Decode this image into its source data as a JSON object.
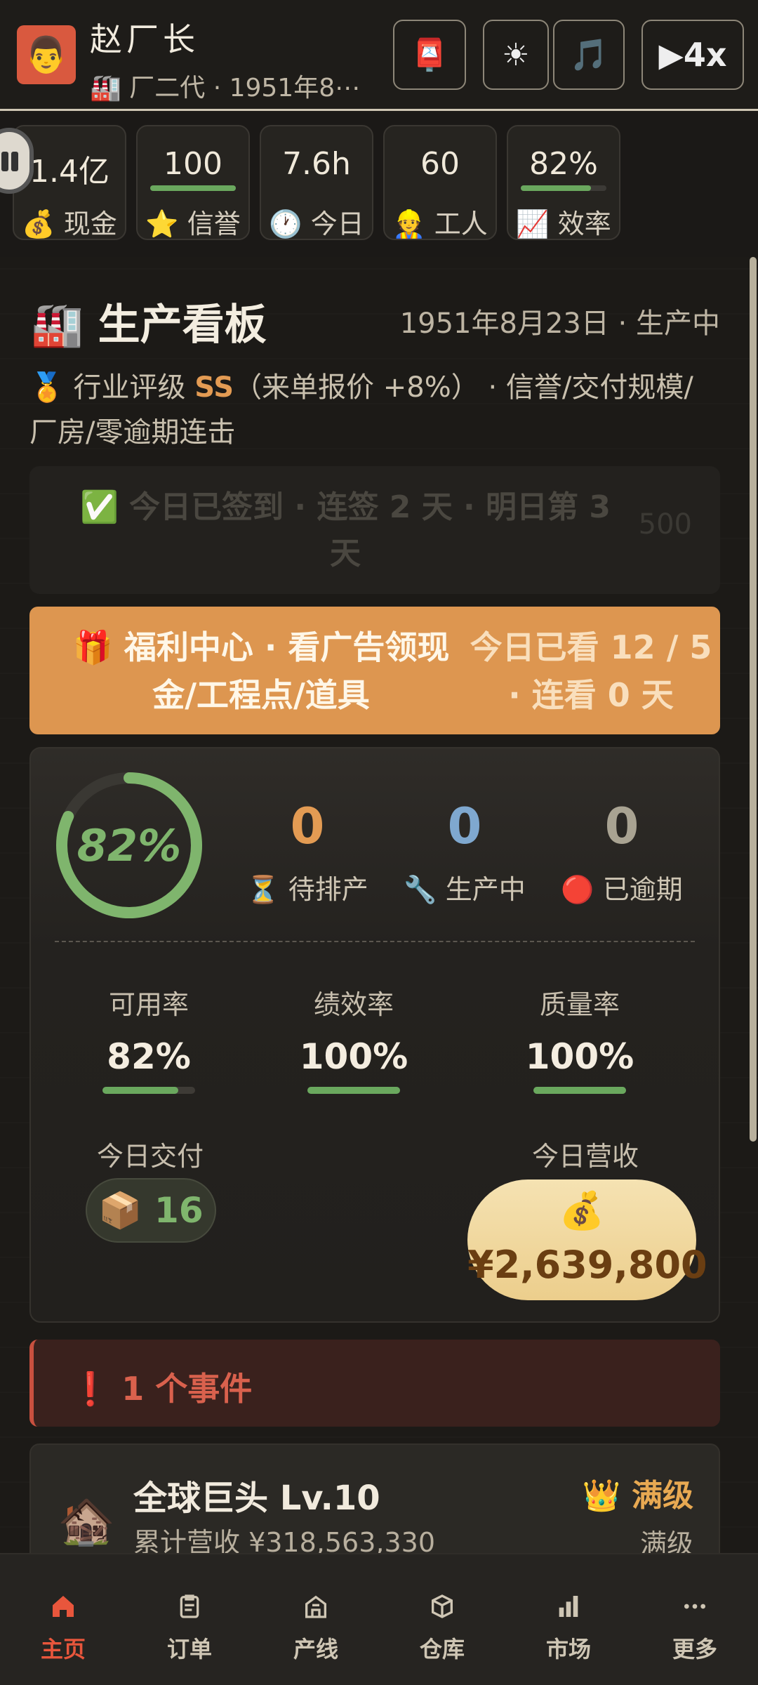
{
  "header": {
    "avatar": "👨",
    "name": "赵厂长",
    "subtitle": "🏭 厂二代 · 1951年8⋯",
    "mail_icon": "📮",
    "sun_icon": "☀",
    "music_icon": "🎵",
    "speed_label": "▶4x"
  },
  "stats": {
    "cash": {
      "value": "1.4亿",
      "label": "💰 现金"
    },
    "credit": {
      "value": "100",
      "label": "⭐ 信誉",
      "progress": 1.0
    },
    "today": {
      "value": "7.6h",
      "label": "🕐 今日"
    },
    "workers": {
      "value": "60",
      "label": "👷 工人"
    },
    "efficiency": {
      "value": "82%",
      "label": "📈 效率",
      "progress": 0.82
    }
  },
  "board": {
    "icon": "🏭",
    "title": "生产看板",
    "date_status": "1951年8月23日 · 生产中",
    "rating_prefix": "🏅 行业评级 ",
    "rating_grade": "SS",
    "rating_suffix": "（来单报价 +8%） · 信誉/交付规模/厂房/零逾期连击"
  },
  "checkin": {
    "text": "✅ 今日已签到 · 连签 2 天 · 明日第 3 天",
    "reward": "500"
  },
  "welfare": {
    "left": "🎁 福利中心 · 看广告领现金/工程点/道具",
    "right": "今日已看 12 / 5 · 连看 0 天"
  },
  "production": {
    "ring_value": "82%",
    "ring_progress": 0.82,
    "pending": {
      "value": "0",
      "label": "⏳ 待排产",
      "color": "#e39b53"
    },
    "producing": {
      "value": "0",
      "label": "🔧 生产中",
      "color": "#7fa8cf"
    },
    "overdue": {
      "value": "0",
      "label": "🔴 已逾期",
      "color": "#a9a392"
    },
    "availability": {
      "label": "可用率",
      "value": "82%",
      "progress": 0.82
    },
    "performance": {
      "label": "绩效率",
      "value": "100%",
      "progress": 1.0
    },
    "quality": {
      "label": "质量率",
      "value": "100%",
      "progress": 1.0
    },
    "delivery_label": "今日交付",
    "delivery_value": "📦 16",
    "revenue_label": "今日营收",
    "revenue_icon": "💰",
    "revenue_value": "¥2,639,800"
  },
  "event": {
    "text": "❗ 1 个事件"
  },
  "level": {
    "icon": "🏚️",
    "name": "全球巨头 Lv.10",
    "cumulative": "累计营收 ¥318,563,330",
    "max_badge": "👑 满级",
    "max_text": "满级"
  },
  "nav": [
    {
      "label": "主页",
      "icon": "home-icon"
    },
    {
      "label": "订单",
      "icon": "clipboard-icon"
    },
    {
      "label": "产线",
      "icon": "factory-icon"
    },
    {
      "label": "仓库",
      "icon": "box-icon"
    },
    {
      "label": "市场",
      "icon": "bar-chart-icon"
    },
    {
      "label": "更多",
      "icon": "more-icon"
    }
  ],
  "colors": {
    "accent": "#e8563c",
    "green": "#6aa85e",
    "orange": "#dd9650"
  }
}
